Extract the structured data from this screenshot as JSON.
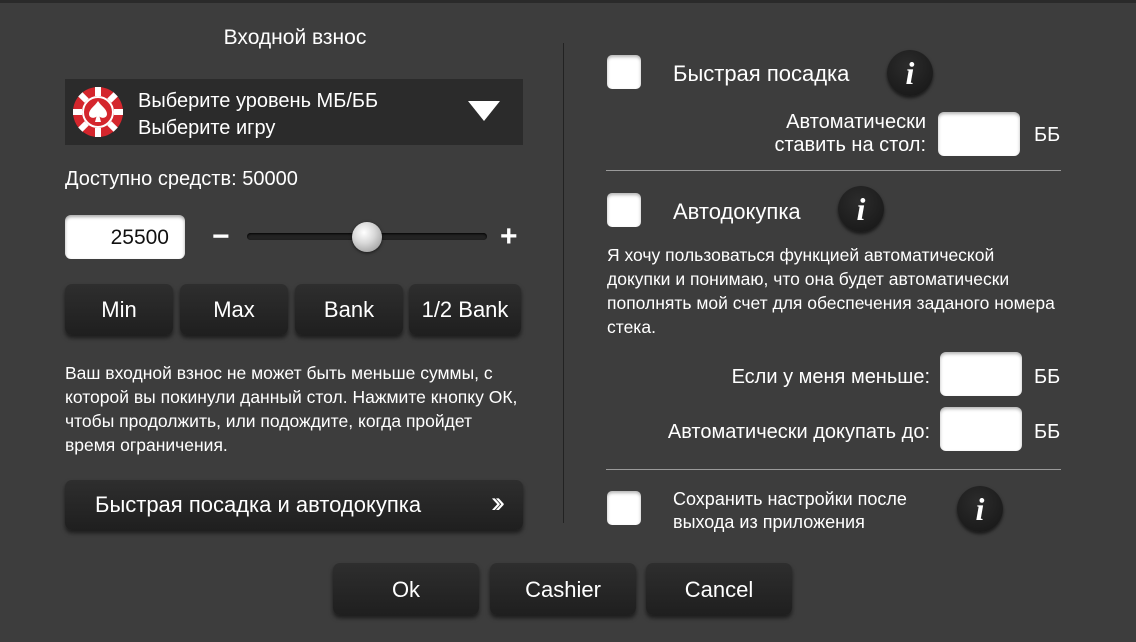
{
  "buy_in": {
    "title": "Входной взнос",
    "dropdown": {
      "line1": "Выберите уровень МБ/ББ",
      "line2": "Выберите игру",
      "chip_icon": "poker-chip-spade-icon",
      "arrow_icon": "triangle-down-icon"
    },
    "available": "Доступно средств: 50000",
    "amount": "25500",
    "minus": "−",
    "plus": "+",
    "slider_fraction": 0.5,
    "presets": [
      "Min",
      "Max",
      "Bank",
      "1/2 Bank"
    ],
    "note": "Ваш входной взнос не может быть меньше суммы, с которой вы покинули данный стол. Нажмите кнопку ОК, чтобы продолжить, или подождите, когда пройдет время ограничения.",
    "fast_button": "Быстрая посадка и автодокупка",
    "fast_button_icon": "double-chevron-right-icon"
  },
  "right": {
    "fast_seat_label": "Быстрая посадка",
    "auto_seat_line1": "Автоматически",
    "auto_seat_line2": "ставить на стол:",
    "unit": "ББ",
    "autobuy_label": "Автодокупка",
    "autobuy_desc": "Я хочу пользоваться функцией автоматической докупки и понимаю, что она будет автоматически пополнять мой счет для обеспечения заданого номера стека.",
    "if_less_label": "Если у меня меньше:",
    "rebuy_to_label": "Автоматически докупать до:",
    "save_line1": "Сохранить настройки после",
    "save_line2": "выхода из приложения",
    "info_glyph": "i",
    "info_icon": "info-icon"
  },
  "footer": {
    "ok": "Ok",
    "cashier": "Cashier",
    "cancel": "Cancel"
  },
  "colors": {
    "background": "#3d3d3d",
    "panel": "#2b2b2b",
    "chip_red": "#d4262d"
  }
}
